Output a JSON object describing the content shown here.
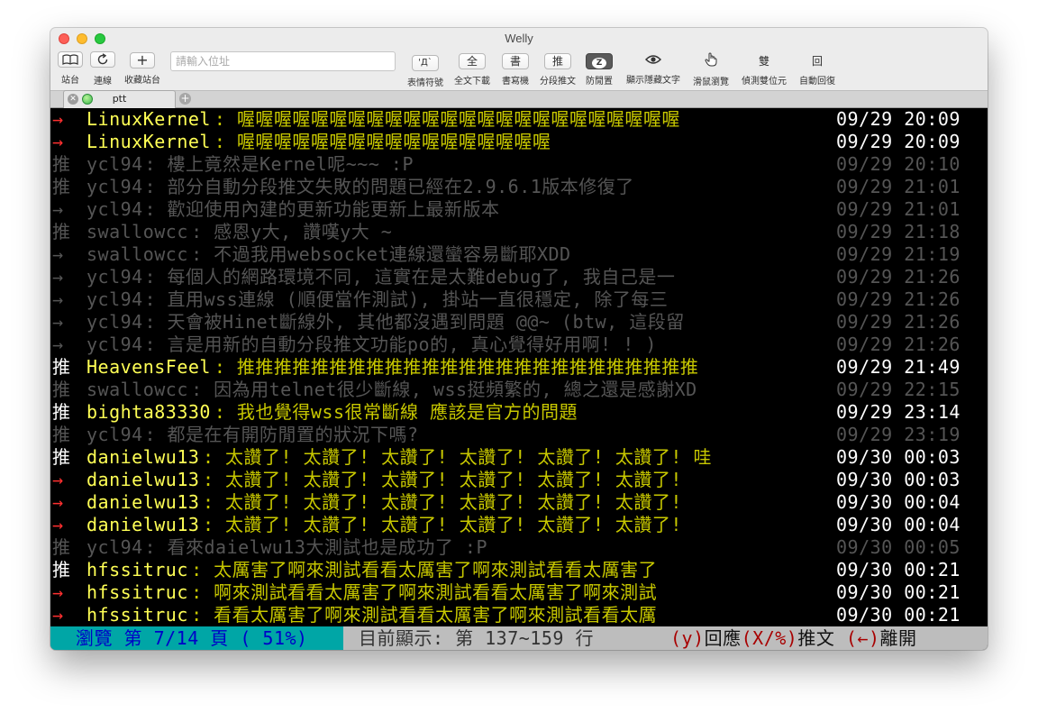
{
  "window": {
    "title": "Welly"
  },
  "toolbar": {
    "sites": {
      "icon": "book-icon",
      "label": "站台"
    },
    "connect": {
      "icon": "refresh-icon",
      "label": "連線"
    },
    "favorites": {
      "icon": "plus-icon",
      "label": "收藏站台"
    },
    "address": {
      "placeholder": "請輸入位址",
      "label": "位址"
    },
    "emoticons": {
      "glyph": "'Д`",
      "label": "表情符號"
    },
    "download_all": {
      "glyph": "全",
      "label": "全文下載"
    },
    "composer": {
      "glyph": "書",
      "label": "書寫機"
    },
    "split_push": {
      "glyph": "推",
      "label": "分段推文"
    },
    "anti_idle": {
      "icon": "zzz-bubble-icon",
      "glyph": "Z",
      "label": "防閒置"
    },
    "show_hidden": {
      "icon": "eye-icon",
      "label": "顯示隱藏文字"
    },
    "mouse_browse": {
      "icon": "hand-cursor-icon",
      "label": "滑鼠瀏覽"
    },
    "detect_double": {
      "glyph": "雙",
      "label": "偵測雙位元"
    },
    "auto_reply": {
      "glyph": "回",
      "label": "自動回復"
    }
  },
  "tabs": [
    {
      "label": "ptt"
    }
  ],
  "colors": {
    "bright_yellow": "#ffff55",
    "dim_yellow": "#c8c800",
    "dim_gray": "#555555",
    "white": "#ffffff",
    "red": "#ff3030"
  },
  "comments": [
    {
      "tag": "→",
      "user": "LinuxKernel",
      "text": "喔喔喔喔喔喔喔喔喔喔喔喔喔喔喔喔喔喔喔喔喔喔喔喔",
      "time": "09/29 20:09",
      "style": "active",
      "tagcolor": "red"
    },
    {
      "tag": "→",
      "user": "LinuxKernel",
      "text": "喔喔喔喔喔喔喔喔喔喔喔喔喔喔喔喔喔",
      "time": "09/29 20:09",
      "style": "active",
      "tagcolor": "red"
    },
    {
      "tag": "推",
      "user": "ycl94",
      "text": "樓上竟然是Kernel呢~~~ :P",
      "time": "09/29 20:10",
      "style": "dim"
    },
    {
      "tag": "推",
      "user": "ycl94",
      "text": "部分自動分段推文失敗的問題已經在2.9.6.1版本修復了",
      "time": "09/29 21:01",
      "style": "dim"
    },
    {
      "tag": "→",
      "user": "ycl94",
      "text": "歡迎使用內建的更新功能更新上最新版本",
      "time": "09/29 21:01",
      "style": "dim"
    },
    {
      "tag": "推",
      "user": "swallowcc",
      "text": "感恩y大, 讚嘆y大 ~",
      "time": "09/29 21:18",
      "style": "dim"
    },
    {
      "tag": "→",
      "user": "swallowcc",
      "text": "不過我用websocket連線還蠻容易斷耶XDD",
      "time": "09/29 21:19",
      "style": "dim"
    },
    {
      "tag": "→",
      "user": "ycl94",
      "text": "每個人的網路環境不同, 這實在是太難debug了, 我自己是一",
      "time": "09/29 21:26",
      "style": "dim"
    },
    {
      "tag": "→",
      "user": "ycl94",
      "text": "直用wss連線 (順便當作測試), 掛站一直很穩定, 除了每三",
      "time": "09/29 21:26",
      "style": "dim"
    },
    {
      "tag": "→",
      "user": "ycl94",
      "text": "天會被Hinet斷線外, 其他都沒遇到問題 @@~ (btw, 這段留",
      "time": "09/29 21:26",
      "style": "dim"
    },
    {
      "tag": "→",
      "user": "ycl94",
      "text": "言是用新的自動分段推文功能po的, 真心覺得好用啊! ! )",
      "time": "09/29 21:26",
      "style": "dim"
    },
    {
      "tag": "推",
      "user": "HeavensFeel",
      "text": "推推推推推推推推推推推推推推推推推推推推推推推推推",
      "time": "09/29 21:49",
      "style": "active",
      "tagcolor": "white"
    },
    {
      "tag": "推",
      "user": "swallowcc",
      "text": "因為用telnet很少斷線, wss挺頻繁的, 總之還是感謝XD",
      "time": "09/29 22:15",
      "style": "dim"
    },
    {
      "tag": "推",
      "user": "bighta83330",
      "text": "我也覺得wss很常斷線 應該是官方的問題",
      "time": "09/29 23:14",
      "style": "active",
      "tagcolor": "white"
    },
    {
      "tag": "推",
      "user": "ycl94",
      "text": "都是在有開防閒置的狀況下嗎?",
      "time": "09/29 23:19",
      "style": "dim"
    },
    {
      "tag": "推",
      "user": "danielwu13",
      "text": "太讚了! 太讚了! 太讚了! 太讚了! 太讚了! 太讚了! 哇",
      "time": "09/30 00:03",
      "style": "active",
      "tagcolor": "white"
    },
    {
      "tag": "→",
      "user": "danielwu13",
      "text": "太讚了! 太讚了! 太讚了! 太讚了! 太讚了! 太讚了!",
      "time": "09/30 00:03",
      "style": "active",
      "tagcolor": "red"
    },
    {
      "tag": "→",
      "user": "danielwu13",
      "text": "太讚了! 太讚了! 太讚了! 太讚了! 太讚了! 太讚了!",
      "time": "09/30 00:04",
      "style": "active",
      "tagcolor": "red"
    },
    {
      "tag": "→",
      "user": "danielwu13",
      "text": "太讚了! 太讚了! 太讚了! 太讚了! 太讚了! 太讚了!",
      "time": "09/30 00:04",
      "style": "active",
      "tagcolor": "red"
    },
    {
      "tag": "推",
      "user": "ycl94",
      "text": "看來daielwu13大測試也是成功了 :P",
      "time": "09/30 00:05",
      "style": "dim"
    },
    {
      "tag": "推",
      "user": "hfssitruc",
      "text": "太厲害了啊來測試看看太厲害了啊來測試看看太厲害了",
      "time": "09/30 00:21",
      "style": "active",
      "tagcolor": "white"
    },
    {
      "tag": "→",
      "user": "hfssitruc",
      "text": "啊來測試看看太厲害了啊來測試看看太厲害了啊來測試",
      "time": "09/30 00:21",
      "style": "active",
      "tagcolor": "red"
    },
    {
      "tag": "→",
      "user": "hfssitruc",
      "text": "看看太厲害了啊來測試看看太厲害了啊來測試看看太厲",
      "time": "09/30 00:21",
      "style": "active",
      "tagcolor": "red"
    }
  ],
  "statusbar": {
    "progress": "瀏覽 第 7/14 頁 ( 51%)",
    "display_range": "目前顯示: 第 137~159 行",
    "reply_key": "(y)",
    "reply_label": "回應",
    "push_key": "(X/%)",
    "push_label": "推文",
    "leave_key": "(←)",
    "leave_label": "離開"
  }
}
